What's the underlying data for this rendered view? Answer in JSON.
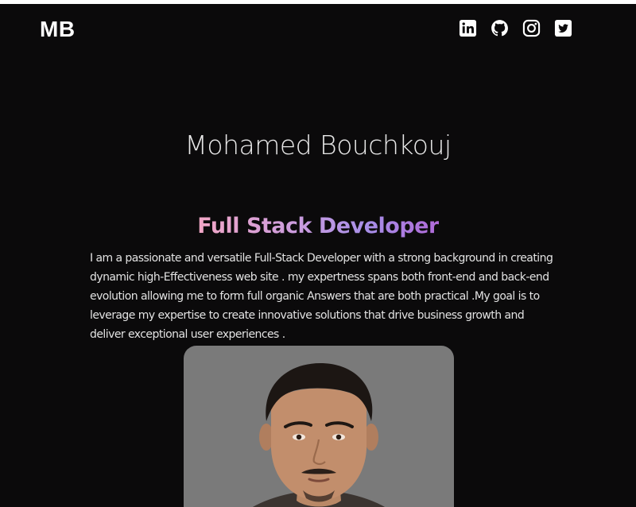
{
  "header": {
    "logo": "MB",
    "socials": [
      {
        "icon": "linkedin-icon",
        "label": "LinkedIn"
      },
      {
        "icon": "github-icon",
        "label": "GitHub"
      },
      {
        "icon": "instagram-icon",
        "label": "Instagram"
      },
      {
        "icon": "twitter-icon",
        "label": "Twitter"
      }
    ]
  },
  "hero": {
    "name": "Mohamed Bouchkouj",
    "role": "Full Stack Developer",
    "bio": "I am a passionate and versatile Full-Stack Developer with a strong background in creating dynamic high-Effectiveness web site . my expertness spans both front-end and back-end evolution allowing me to form full organic Answers that are both practical .My goal is to leverage my expertise to create innovative solutions that drive business growth and deliver exceptional user experiences ."
  },
  "colors": {
    "background": "#0b0a0b",
    "text": "#e6e6e6",
    "gradient_start": "#f2a7c6",
    "gradient_end": "#b06ad8",
    "photo_background": "#7a7a7a"
  }
}
